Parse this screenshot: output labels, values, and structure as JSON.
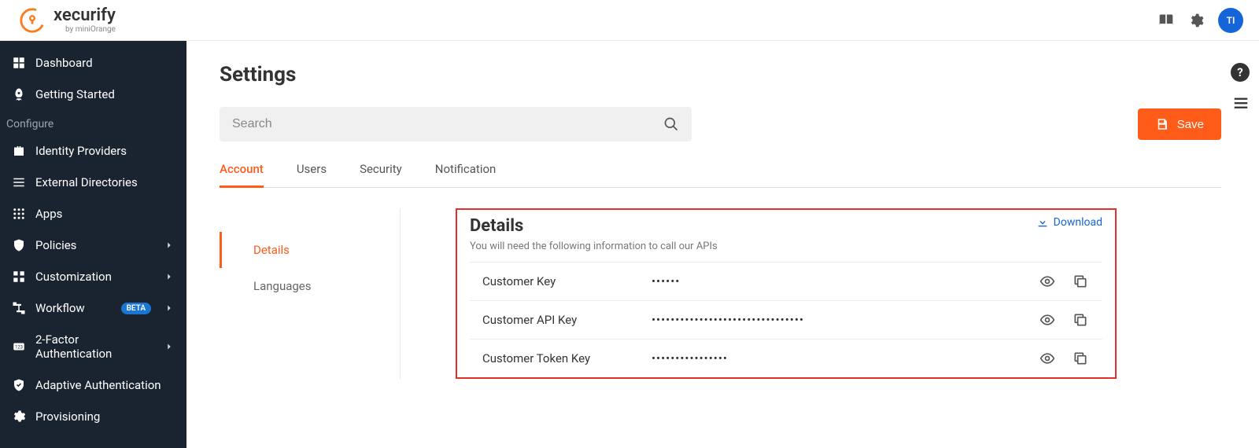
{
  "brand": {
    "name": "xecurify",
    "byline": "by miniOrange"
  },
  "avatar": "TI",
  "sidebar": {
    "items": [
      {
        "icon": "dashboard",
        "label": "Dashboard"
      },
      {
        "icon": "rocket",
        "label": "Getting Started"
      }
    ],
    "section_label": "Configure",
    "config_items": [
      {
        "icon": "briefcase",
        "label": "Identity Providers"
      },
      {
        "icon": "list",
        "label": "External Directories"
      },
      {
        "icon": "apps",
        "label": "Apps"
      },
      {
        "icon": "shield",
        "label": "Policies",
        "chevron": true
      },
      {
        "icon": "customize",
        "label": "Customization",
        "chevron": true
      },
      {
        "icon": "workflow",
        "label": "Workflow",
        "beta": "BETA",
        "chevron": true
      },
      {
        "icon": "twofa",
        "label": "2-Factor Authentication",
        "chevron": true
      },
      {
        "icon": "adaptive",
        "label": "Adaptive Authentication"
      },
      {
        "icon": "gear-sm",
        "label": "Provisioning"
      }
    ]
  },
  "page": {
    "title": "Settings"
  },
  "search": {
    "placeholder": "Search"
  },
  "save_label": "Save",
  "tabs": [
    "Account",
    "Users",
    "Security",
    "Notification"
  ],
  "subnav": [
    "Details",
    "Languages"
  ],
  "details": {
    "title": "Details",
    "subtitle": "You will need the following information to call our APIs",
    "download_label": "Download",
    "rows": [
      {
        "label": "Customer Key",
        "value": "••••••"
      },
      {
        "label": "Customer API Key",
        "value": "••••••••••••••••••••••••••••••••"
      },
      {
        "label": "Customer Token Key",
        "value": "••••••••••••••••"
      }
    ]
  }
}
